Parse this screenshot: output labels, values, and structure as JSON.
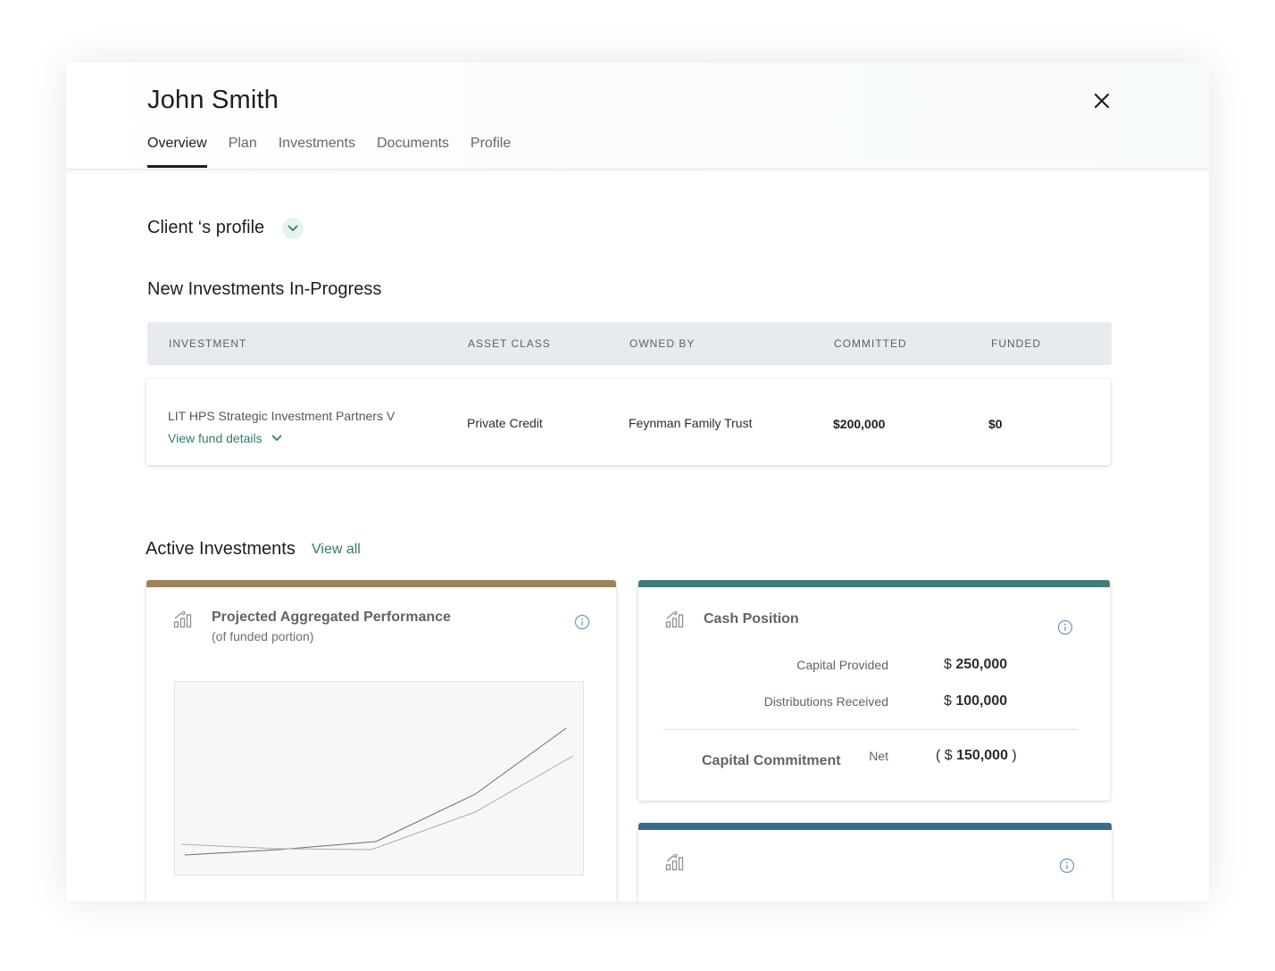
{
  "header": {
    "client_name": "John Smith",
    "tabs": [
      {
        "label": "Overview",
        "active": true
      },
      {
        "label": "Plan",
        "active": false
      },
      {
        "label": "Investments",
        "active": false
      },
      {
        "label": "Documents",
        "active": false
      },
      {
        "label": "Profile",
        "active": false
      }
    ],
    "close_icon": "close-icon"
  },
  "profile": {
    "title": "Client ‘s profile",
    "toggle_icon": "chevron-down-icon"
  },
  "new_investments": {
    "title": "New Investments In-Progress",
    "columns": [
      "INVESTMENT",
      "ASSET CLASS",
      "OWNED BY",
      "COMMITTED",
      "FUNDED"
    ],
    "rows": [
      {
        "investment": "LIT HPS Strategic Investment Partners V",
        "link": "View fund details",
        "asset_class": "Private Credit",
        "owned_by": "Feynman Family Trust",
        "committed": "$200,000",
        "funded": "$0"
      }
    ]
  },
  "active_investments": {
    "title": "Active Investments",
    "view_all": "View all",
    "performance_card": {
      "title": "Projected Aggregated Performance",
      "subtitle": "(of funded portion)",
      "accent_color": "#9b8456"
    },
    "cash_card": {
      "title": "Cash Position",
      "accent_color": "#3a7f7a",
      "capital_provided_label": "Capital Provided",
      "capital_provided_currency": "$",
      "capital_provided_value": "250,000",
      "distributions_label": "Distributions Received",
      "distributions_currency": "$",
      "distributions_value": "100,000",
      "commitment_label": "Capital Commitment",
      "net_label": "Net",
      "net_open": "( $",
      "net_value": "150,000",
      "net_close": ")"
    },
    "third_card": {
      "accent_color": "#3c6a8c"
    }
  }
}
